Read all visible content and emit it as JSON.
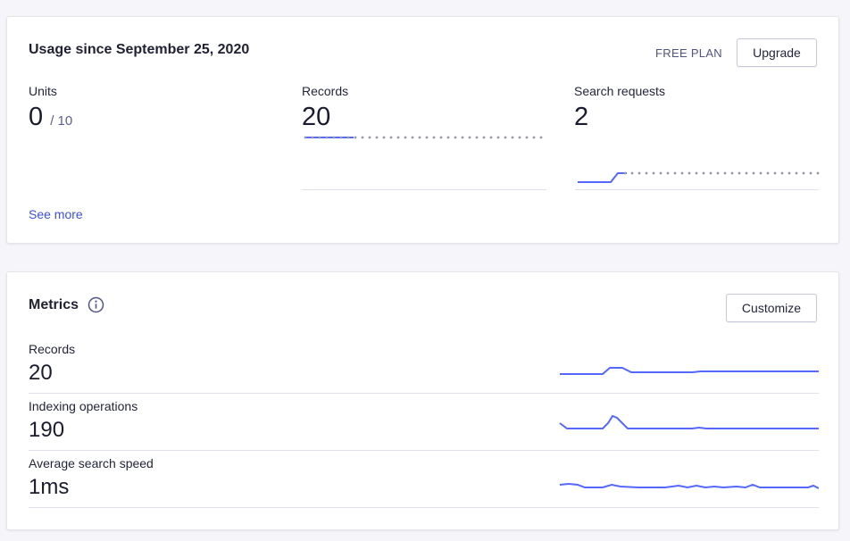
{
  "usage": {
    "title": "Usage since September 25, 2020",
    "plan": "FREE PLAN",
    "upgrade_label": "Upgrade",
    "units": {
      "label": "Units",
      "value": "0",
      "limit": "/ 10"
    },
    "records": {
      "label": "Records",
      "value": "20"
    },
    "search_requests": {
      "label": "Search requests",
      "value": "2"
    },
    "see_more": "See more"
  },
  "metrics": {
    "title": "Metrics",
    "customize_label": "Customize",
    "rows": [
      {
        "label": "Records",
        "value": "20"
      },
      {
        "label": "Indexing operations",
        "value": "190"
      },
      {
        "label": "Average search speed",
        "value": "1ms"
      }
    ]
  },
  "colors": {
    "accent": "#5468ff",
    "link": "#3c4fe0",
    "dots": "#9698a6"
  },
  "icons": {
    "info": "info-icon"
  }
}
